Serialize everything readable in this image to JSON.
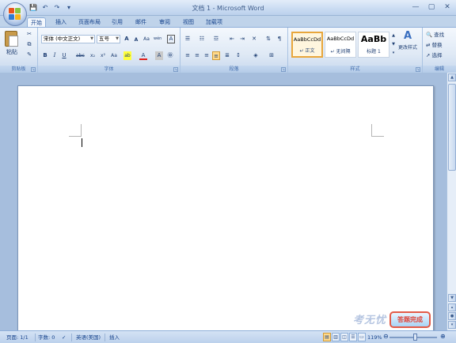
{
  "window": {
    "title": "文档 1 - Microsoft Word",
    "controls": [
      "—",
      "▢",
      "✕"
    ]
  },
  "qat": [
    "💾",
    "↶",
    "↷",
    "▾"
  ],
  "tabs": [
    "开始",
    "插入",
    "页面布局",
    "引用",
    "邮件",
    "审阅",
    "视图",
    "加载项"
  ],
  "active_tab": "开始",
  "ribbon": {
    "clipboard": {
      "paste_label": "粘贴",
      "group_label": "剪贴板"
    },
    "font": {
      "font_name": "宋体 (中文正文)",
      "font_size": "五号",
      "group_label": "字体",
      "buttons_row1": [
        "A",
        "A",
        "Aa",
        "wén",
        "A"
      ],
      "buttons_row2": [
        "B",
        "I",
        "U",
        "abc",
        "x₂",
        "x²",
        "Aa",
        "ab",
        "A",
        "A",
        "㊥"
      ]
    },
    "paragraph": {
      "group_label": "段落"
    },
    "styles": {
      "group_label": "样式",
      "items": [
        {
          "sample": "AaBbCcDd",
          "name": "↵ 正文"
        },
        {
          "sample": "AaBbCcDd",
          "name": "↵ 无间隔"
        },
        {
          "sample": "AaBb",
          "name": "标题 1"
        }
      ],
      "change_styles": "更改样式"
    },
    "editing": {
      "group_label": "编辑",
      "find": "查找",
      "replace": "替换",
      "select": "选择"
    }
  },
  "watermark": "考无忧",
  "answer_button": "答题完成",
  "status": {
    "page": "页面: 1/1",
    "words": "字数: 0",
    "language": "英语(美国)",
    "mode": "插入",
    "zoom": "119%"
  }
}
